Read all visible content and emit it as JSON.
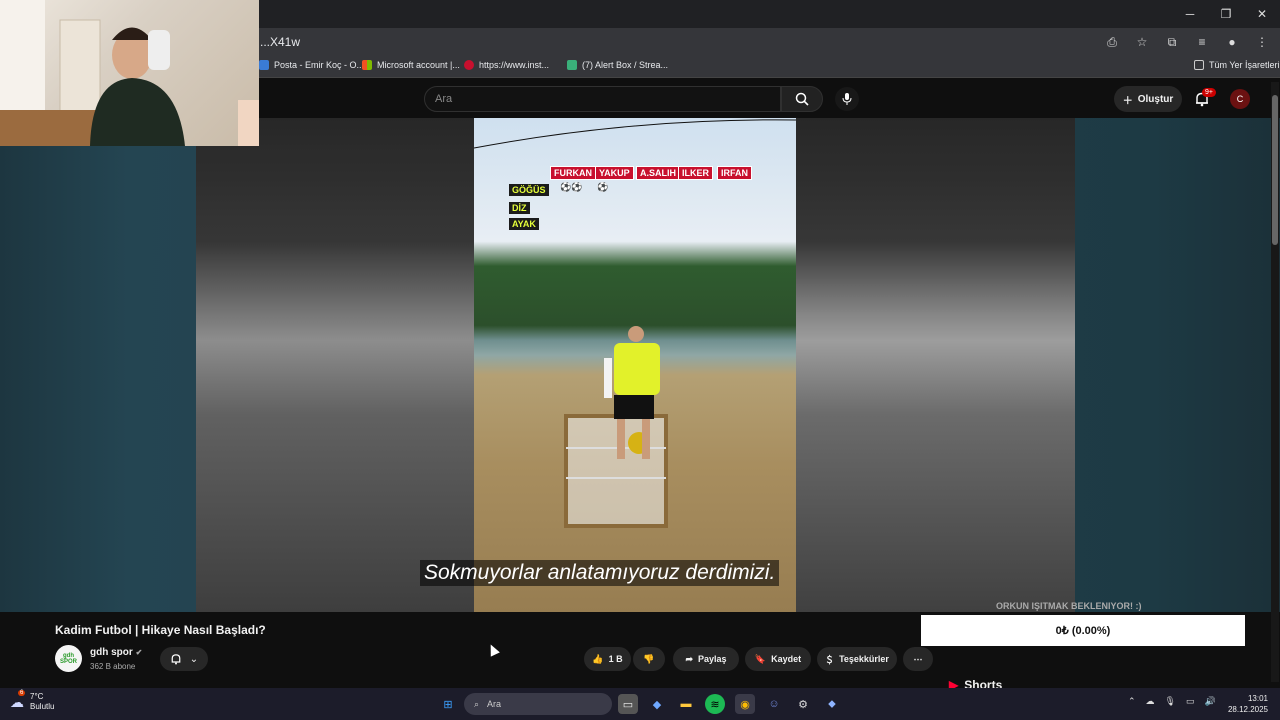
{
  "browser": {
    "address": "...X41w",
    "bookmarks": [
      "Posta - Emir Koç - O...",
      "Microsoft account |...",
      "https://www.inst...",
      "(7) Alert Box / Strea..."
    ],
    "all_bookmarks": "Tüm Yer İşaretleri"
  },
  "header": {
    "search_placeholder": "Ara",
    "create_label": "Oluştur",
    "notification_count": "9+",
    "avatar_letter": "C"
  },
  "overlay": {
    "names": [
      "FURKAN",
      "YAKUP",
      "A.SALIH",
      "ILKER",
      "IRFAN"
    ],
    "rows": [
      "GÖĞÜS",
      "DİZ",
      "AYAK"
    ],
    "balls": "⚽⚽      ⚽"
  },
  "caption": "Sokmuyorlar anlatamıyoruz derdimizi.",
  "video": {
    "title": "Kadim Futbol | Hikaye Nasıl Başladı?",
    "channel_name": "gdh spor",
    "channel_logo_text": "gdh SPOR",
    "subscribers": "362 B abone",
    "likes": "1 B",
    "share": "Paylaş",
    "save": "Kaydet",
    "thanks": "Teşekkürler"
  },
  "donation": {
    "title": "ORKUN IŞITMAK BEKLENIYOR! :)",
    "amount": "0₺ (0.00%)"
  },
  "shorts_label": "Shorts",
  "taskbar": {
    "temperature": "7°C",
    "weather": "Bulutlu",
    "weather_badge": "6",
    "search": "Ara",
    "time": "13:01",
    "date": "28.12.2025"
  }
}
